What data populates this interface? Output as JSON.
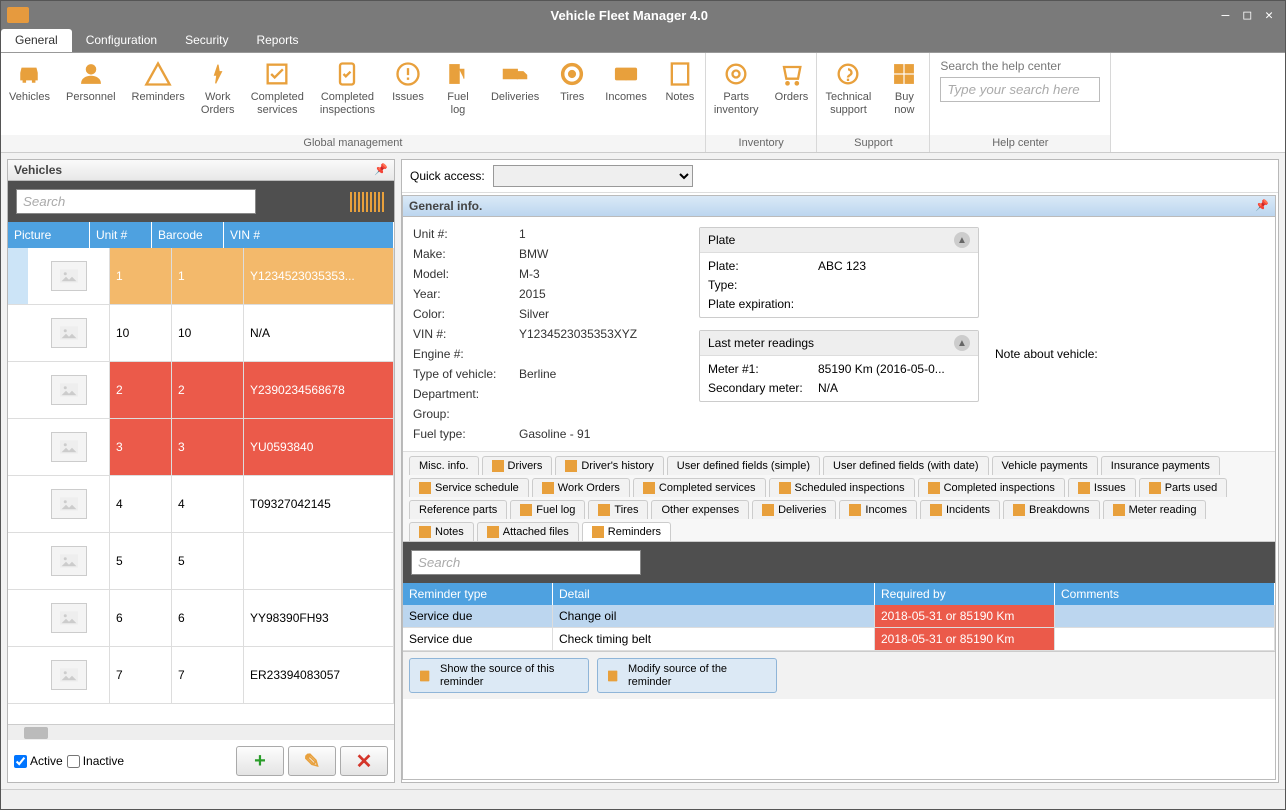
{
  "window": {
    "title": "Vehicle Fleet Manager 4.0"
  },
  "menu_tabs": [
    "General",
    "Configuration",
    "Security",
    "Reports"
  ],
  "menu_active": "General",
  "ribbon": {
    "groups": [
      {
        "label": "Global management",
        "items": [
          "Vehicles",
          "Personnel",
          "Reminders",
          "Work Orders",
          "Completed services",
          "Completed inspections",
          "Issues",
          "Fuel log",
          "Deliveries",
          "Tires",
          "Incomes",
          "Notes"
        ]
      },
      {
        "label": "Inventory",
        "items": [
          "Parts inventory",
          "Orders"
        ]
      },
      {
        "label": "Support",
        "items": [
          "Technical support",
          "Buy now"
        ]
      }
    ],
    "help": {
      "label": "Search the help center",
      "placeholder": "Type your search here",
      "group_label": "Help center"
    }
  },
  "left": {
    "title": "Vehicles",
    "search_placeholder": "Search",
    "columns": [
      "Picture",
      "Unit #",
      "Barcode",
      "VIN #"
    ],
    "rows": [
      {
        "unit": "1",
        "barcode": "1",
        "vin": "Y1234523035353...",
        "state": "selected"
      },
      {
        "unit": "10",
        "barcode": "10",
        "vin": "N/A",
        "state": ""
      },
      {
        "unit": "2",
        "barcode": "2",
        "vin": "Y2390234568678",
        "state": "alert"
      },
      {
        "unit": "3",
        "barcode": "3",
        "vin": "YU0593840",
        "state": "alert"
      },
      {
        "unit": "4",
        "barcode": "4",
        "vin": "T09327042145",
        "state": ""
      },
      {
        "unit": "5",
        "barcode": "5",
        "vin": "",
        "state": ""
      },
      {
        "unit": "6",
        "barcode": "6",
        "vin": "YY98390FH93",
        "state": ""
      },
      {
        "unit": "7",
        "barcode": "7",
        "vin": "ER23394083057",
        "state": ""
      }
    ],
    "active_label": "Active",
    "inactive_label": "Inactive"
  },
  "right": {
    "quick_access_label": "Quick access:",
    "general_info_title": "General info.",
    "fields": {
      "unit_no_k": "Unit #:",
      "unit_no_v": "1",
      "make_k": "Make:",
      "make_v": "BMW",
      "model_k": "Model:",
      "model_v": "M-3",
      "year_k": "Year:",
      "year_v": "2015",
      "color_k": "Color:",
      "color_v": "Silver",
      "vin_k": "VIN #:",
      "vin_v": "Y1234523035353XYZ",
      "engine_k": "Engine #:",
      "engine_v": "",
      "type_k": "Type of vehicle:",
      "type_v": "Berline",
      "dept_k": "Department:",
      "dept_v": "",
      "group_k": "Group:",
      "group_v": "",
      "fuel_k": "Fuel type:",
      "fuel_v": "Gasoline - 91"
    },
    "plate_card": {
      "title": "Plate",
      "plate_k": "Plate:",
      "plate_v": "ABC 123",
      "type_k": "Type:",
      "type_v": "",
      "exp_k": "Plate expiration:",
      "exp_v": ""
    },
    "meter_card": {
      "title": "Last meter readings",
      "m1_k": "Meter #1:",
      "m1_v": "85190 Km (2016-05-0...",
      "m2_k": "Secondary meter:",
      "m2_v": "N/A"
    },
    "note_label": "Note about vehicle:",
    "detail_tabs": [
      "Misc. info.",
      "Drivers",
      "Driver's history",
      "User defined fields (simple)",
      "User defined fields (with date)",
      "Vehicle payments",
      "Insurance payments",
      "Service schedule",
      "Work Orders",
      "Completed services",
      "Scheduled inspections",
      "Completed inspections",
      "Issues",
      "Parts used",
      "Reference parts",
      "Fuel log",
      "Tires",
      "Other expenses",
      "Deliveries",
      "Incomes",
      "Incidents",
      "Breakdowns",
      "Meter reading",
      "Notes",
      "Attached files",
      "Reminders"
    ],
    "detail_tab_active": "Reminders",
    "reminders": {
      "search_placeholder": "Search",
      "columns": [
        "Reminder type",
        "Detail",
        "Required by",
        "Comments"
      ],
      "rows": [
        {
          "type": "Service due",
          "detail": "Change oil",
          "required": "2018-05-31 or 85190 Km",
          "comments": "",
          "sel": true
        },
        {
          "type": "Service due",
          "detail": "Check timing belt",
          "required": "2018-05-31 or 85190 Km",
          "comments": "",
          "sel": false
        }
      ],
      "btn1": "Show the source of this reminder",
      "btn2": "Modify source of the reminder"
    }
  }
}
